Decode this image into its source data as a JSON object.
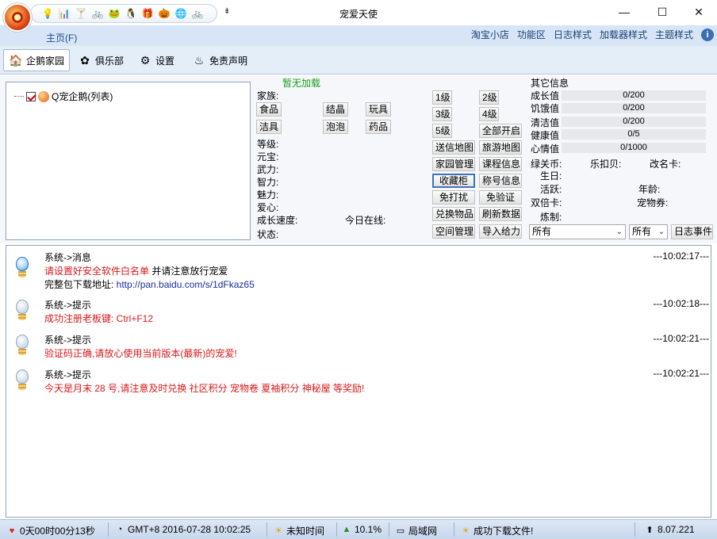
{
  "window": {
    "title": "宠爱天使",
    "minimize_icon": "—",
    "maximize_icon": "☐",
    "close_icon": "✕"
  },
  "quickbar": {
    "icons": [
      "💡",
      "📊",
      "🍸",
      "🚲",
      "🐸",
      "🐧",
      "🎁",
      "🎃",
      "🌐",
      "🚲"
    ],
    "dropdown_icon": "⇟"
  },
  "menu": {
    "home": "主页(F)",
    "items": [
      "淘宝小店",
      "功能区",
      "日志样式",
      "加载器样式",
      "主题样式"
    ]
  },
  "tabs": [
    {
      "label": "企鹅家园",
      "icon": "🏠"
    },
    {
      "label": "俱乐部",
      "icon": "✿"
    },
    {
      "label": "设置",
      "icon": "⚙"
    },
    {
      "label": "免责声明",
      "icon": "♨"
    }
  ],
  "tree": {
    "node_label": "Q宠企鹅(列表)"
  },
  "pet": {
    "load_status": "暂无加载",
    "family_label": "家族:",
    "item_buttons": [
      "食品",
      "结晶",
      "玩具",
      "洁具",
      "泡泡",
      "药品"
    ],
    "attributes": [
      "等级:",
      "元宝:",
      "武力:",
      "智力:",
      "魅力:",
      "爱心:",
      "成长速度:",
      "状态:"
    ],
    "today_online": "今日在线:"
  },
  "actions": {
    "level_buttons": [
      "1级",
      "2级",
      "3级",
      "4级",
      "5级",
      "全部开启"
    ],
    "buttons": [
      "送信地图",
      "旅游地图",
      "家园管理",
      "课程信息",
      "收藏柜",
      "称号信息",
      "免打扰",
      "免验证",
      "兑换物品",
      "刷新数据",
      "空间管理",
      "导入给力"
    ]
  },
  "other_info": {
    "title": "其它信息",
    "stats": [
      {
        "label": "成长值",
        "value": "0/200"
      },
      {
        "label": "饥饿值",
        "value": "0/200"
      },
      {
        "label": "清洁值",
        "value": "0/200"
      },
      {
        "label": "健康值",
        "value": "0/5"
      },
      {
        "label": "心情值",
        "value": "0/1000"
      }
    ],
    "fields": [
      "绿关币:",
      "乐扣贝:",
      "改名卡:",
      "生日:",
      "活跃:",
      "年龄:",
      "双倍卡:",
      "宠物券:",
      "炼制:"
    ],
    "filter1": "所有",
    "filter2": "所有",
    "log_events_button": "日志事件"
  },
  "log": [
    {
      "title": "系统->消息",
      "time": "---10:02:17---",
      "lines": [
        {
          "text": "请设置好安全软件白名单",
          "suffix": " 并请注意放行宠爱"
        },
        {
          "text": "完整包下载地址: ",
          "link": "http://pan.baidu.com/s/1dFkaz65"
        }
      ]
    },
    {
      "title": "系统->提示",
      "time": "---10:02:18---",
      "lines": [
        {
          "text": "成功注册老板键: Ctrl+F12"
        }
      ]
    },
    {
      "title": "系统->提示",
      "time": "---10:02:21---",
      "lines": [
        {
          "text": "验证码正确,请放心使用当前版本(最新)的宠爱!"
        }
      ]
    },
    {
      "title": "系统->提示",
      "time": "---10:02:21---",
      "lines": [
        {
          "text": "今天是月末 28 号,请注意及时兑换 社区积分 宠物卷 夏袖积分 神秘屋 等奖励!"
        }
      ]
    }
  ],
  "statusbar": {
    "runtime": "0天00时00分13秒",
    "clock": "GMT+8 2016-07-28 10:02:25",
    "unknown_time": "未知时间",
    "percent": "10.1%",
    "network": "局域网",
    "download_status": "成功下载文件!",
    "version": "8.07.221"
  }
}
